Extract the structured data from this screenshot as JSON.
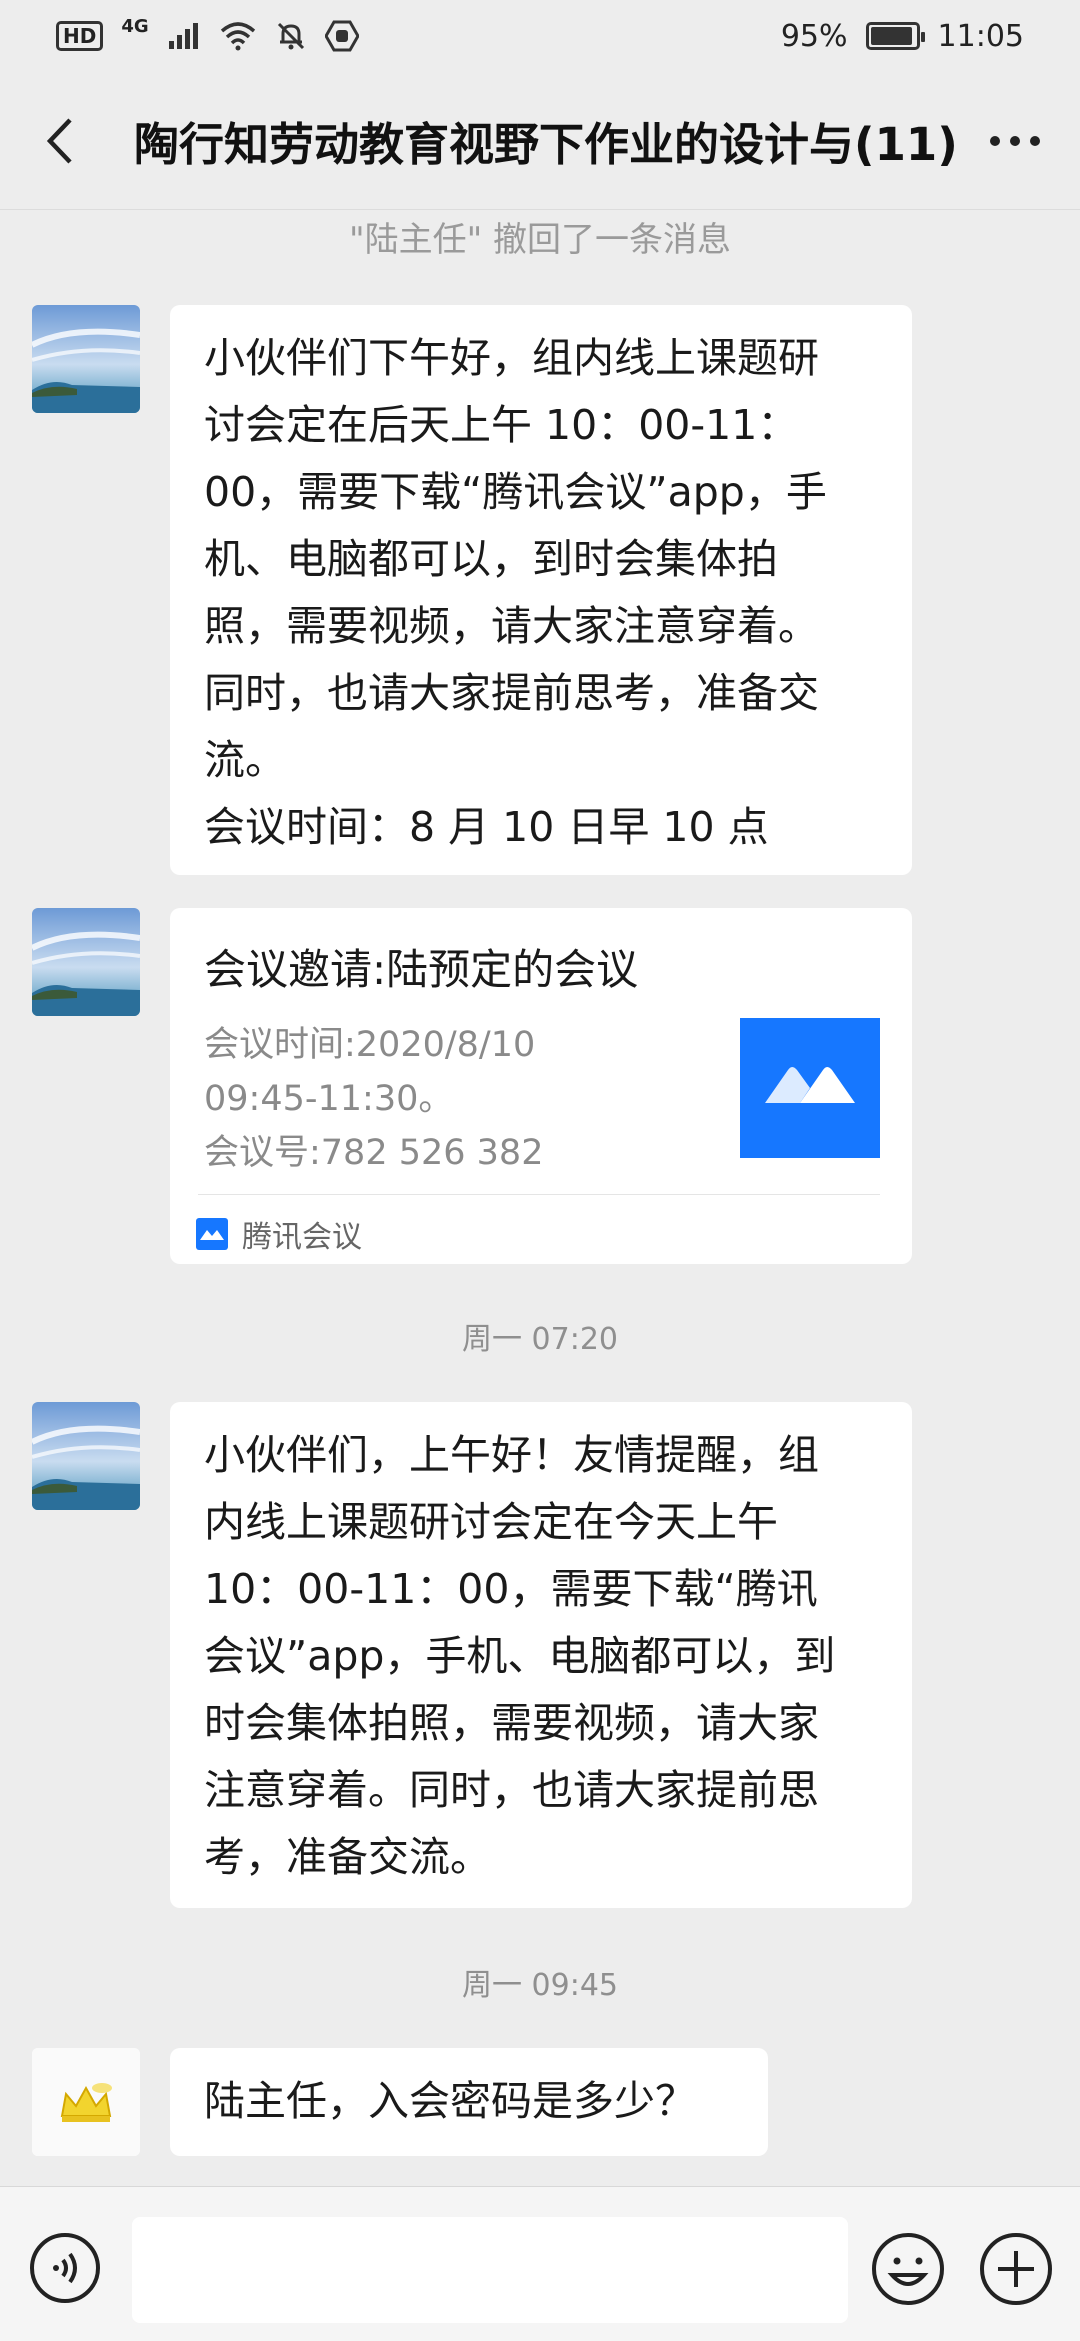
{
  "status_bar": {
    "hd": "HD",
    "network": "4G",
    "battery_percent": "95%",
    "battery_level": 0.95,
    "time": "11:05"
  },
  "header": {
    "title": "陶行知劳动教育视野下作业的设计与(11)",
    "back_icon": "chevron-left-icon",
    "more_icon": "more-dots-icon"
  },
  "recall_notice": "\"陆主任\" 撤回了一条消息",
  "messages": [
    {
      "type": "text",
      "text": "小伙伴们下午好，组内线上课题研\n讨会定在后天上午 10：00-11：\n00，需要下载“腾讯会议”app，手\n机、电脑都可以，到时会集体拍\n照，需要视频，请大家注意穿着。\n同时，也请大家提前思考，准备交\n流。\n会议时间：8 月 10 日早 10 点"
    },
    {
      "type": "card",
      "title": "会议邀请:陆预定的会议",
      "line1": "会议时间:2020/8/10",
      "line2": "09:45-11:30。",
      "line3": "会议号:782 526 382",
      "footer_label": "腾讯会议"
    },
    {
      "type": "text",
      "text": "小伙伴们，上午好！友情提醒，组\n内线上课题研讨会定在今天上午\n10：00-11：00，需要下载“腾讯\n会议”app，手机、电脑都可以，到\n时会集体拍照，需要视频，请大家\n注意穿着。同时，也请大家提前思\n考，准备交流。"
    },
    {
      "type": "text",
      "text": "陆主任，入会密码是多少？"
    }
  ],
  "timestamps": [
    "周一 07:20",
    "周一 09:45"
  ],
  "input_bar": {
    "voice_icon": "voice-icon",
    "emoji_icon": "emoji-icon",
    "plus_icon": "plus-icon"
  },
  "colors": {
    "background": "#ededed",
    "bubble": "#ffffff",
    "meeting_brand": "#1677ff"
  }
}
